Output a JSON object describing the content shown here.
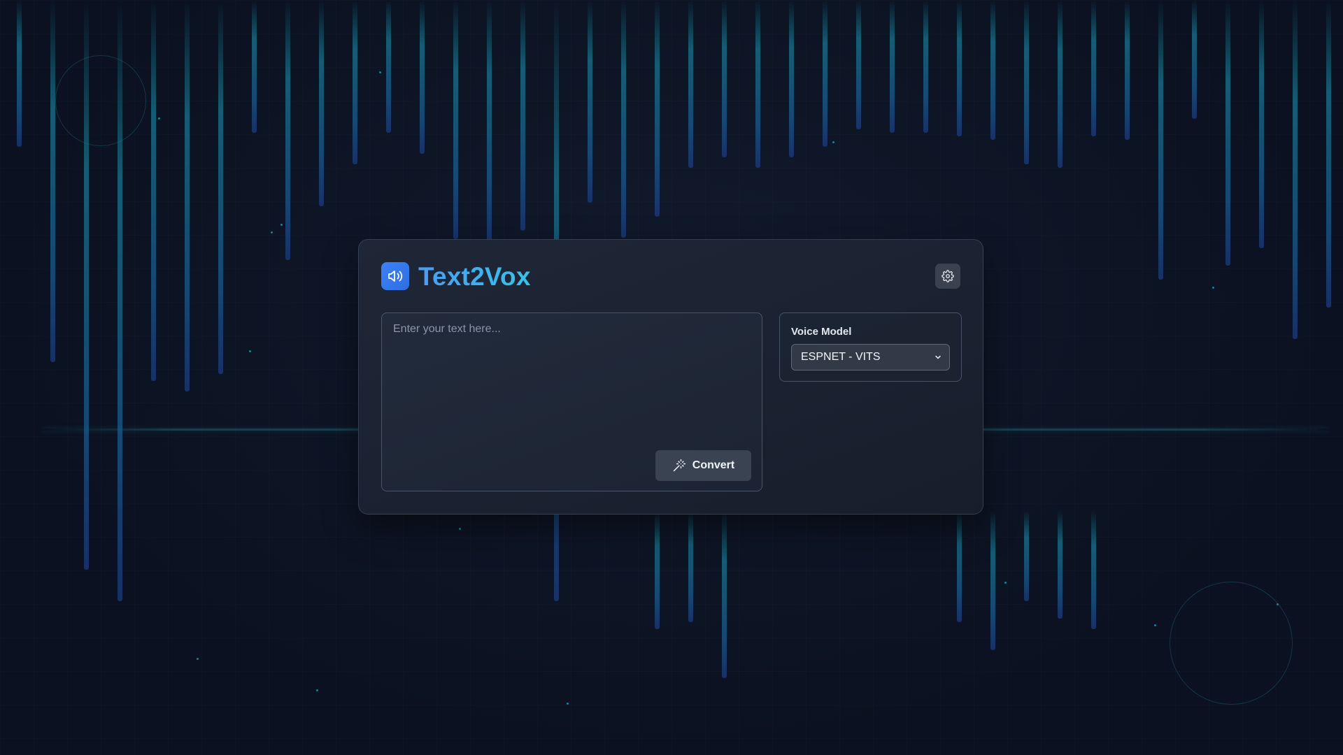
{
  "app": {
    "title": "Text2Vox",
    "logo_icon": "speaker-volume-icon",
    "settings_icon": "gear-icon"
  },
  "editor": {
    "placeholder": "Enter your text here...",
    "value": "",
    "convert_label": "Convert",
    "convert_icon": "magic-wand-icon"
  },
  "voice": {
    "label": "Voice Model",
    "selected": "ESPNET - VITS",
    "dropdown_icon": "chevron-down-icon"
  },
  "colors": {
    "background": "#0b1120",
    "accent_blue": "#3b82f6",
    "accent_cyan": "#38c2e8",
    "bar_teal": "#156a82"
  }
}
